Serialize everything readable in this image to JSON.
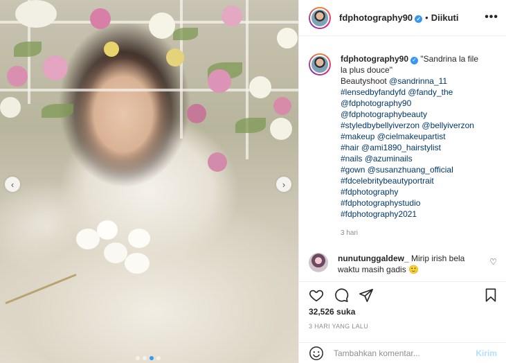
{
  "post": {
    "username": "fdphotography90",
    "follow_status": "Diikuti",
    "more_icon": "more-horizontal-icon",
    "photo_alt": "Woman in white gown sitting among flowers"
  },
  "caption": {
    "username": "fdphotography90",
    "lines": [
      "\"Sandrina la file",
      "la plus douce\"",
      "Beautyshoot",
      "@sandrinna_11",
      "#lensedbyfandyfd",
      "@fandy_the",
      "@fdphotography90",
      "@fdphotographybeauty",
      "#styledbybellyiverzon",
      "@bellyiverzon",
      "#makeup",
      "@cielmakeupartist",
      "#hair",
      "@ami1890_hairstylist",
      "#nails",
      "@azuminails",
      "#gown",
      "@susanzhuang_official",
      "#fdcelebritybeautyportrait",
      "#fdphotography",
      "#fdphotographystudio",
      "#fdphotography2021"
    ],
    "time": "3 hari"
  },
  "comment": {
    "username": "nunutunggaldew_",
    "text": "Mirip irish bela waktu masih gadis 🙂"
  },
  "stats": {
    "likes": "32,526 suka",
    "posted_ago": "3 HARI YANG LALU"
  },
  "composer": {
    "placeholder": "Tambahkan komentar...",
    "post_label": "Kirim"
  },
  "colors": {
    "link": "#00376b",
    "verified": "#3897f0",
    "post_button_disabled": "#b2dffc",
    "muted": "#8e8e8e"
  }
}
